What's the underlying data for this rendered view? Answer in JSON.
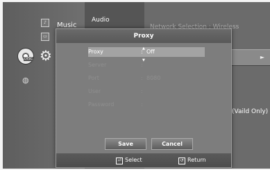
{
  "menu": {
    "left_label": "Music",
    "category_label": "Audio",
    "right_heading": "Network Selection : Wireless",
    "right_note": "(Vaild Only)"
  },
  "icons": {
    "disc": "disc-icon",
    "gear": "gear-icon",
    "globe": "globe-icon",
    "disc_badge": "DISC"
  },
  "dialog": {
    "title": "Proxy",
    "rows": [
      {
        "label": "Proxy",
        "value": "Off",
        "state": "active"
      },
      {
        "label": "Server",
        "value": "",
        "state": "dim"
      },
      {
        "label": "Port",
        "value": "8080",
        "state": "dim"
      },
      {
        "label": "User",
        "value": "",
        "state": "dim"
      },
      {
        "label": "Password",
        "value": "",
        "state": "dim"
      }
    ],
    "buttons": {
      "save": "Save",
      "cancel": "Cancel"
    },
    "footer": {
      "select": "Select",
      "return": "Return"
    }
  }
}
